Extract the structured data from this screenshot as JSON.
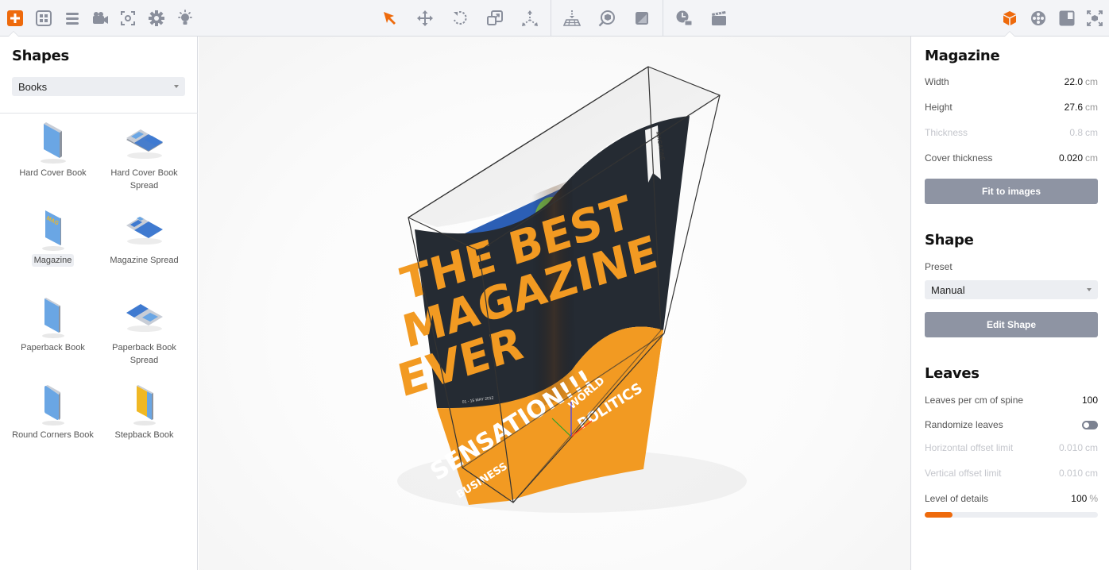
{
  "colors": {
    "accent": "#ee6a0c",
    "icon": "#8a8f9c",
    "button": "#8e94a3"
  },
  "toolbar": {
    "left": [
      {
        "name": "add-icon",
        "active": true
      },
      {
        "name": "library-icon"
      },
      {
        "name": "list-icon"
      },
      {
        "name": "camera-icon"
      },
      {
        "name": "focus-icon"
      },
      {
        "name": "settings-icon"
      },
      {
        "name": "light-icon"
      }
    ],
    "center": [
      {
        "name": "select-icon",
        "active": true
      },
      {
        "name": "move-icon"
      },
      {
        "name": "rotate-icon"
      },
      {
        "name": "scale-icon"
      },
      {
        "name": "explode-icon"
      },
      {
        "name": "drop-to-floor-icon"
      },
      {
        "name": "zoom-to-object-icon"
      },
      {
        "name": "material-icon"
      },
      {
        "name": "timeline-icon"
      },
      {
        "name": "animation-icon"
      }
    ],
    "right": [
      {
        "name": "object-icon",
        "active": true
      },
      {
        "name": "environment-icon"
      },
      {
        "name": "frame-icon"
      },
      {
        "name": "fullscreen-icon"
      }
    ]
  },
  "left_panel": {
    "title": "Shapes",
    "category": "Books",
    "items": [
      {
        "label": "Hard Cover Book",
        "icon": "hard-cover-book-icon"
      },
      {
        "label": "Hard Cover Book Spread",
        "icon": "hard-cover-book-spread-icon"
      },
      {
        "label": "Magazine",
        "icon": "magazine-icon",
        "selected": true
      },
      {
        "label": "Magazine Spread",
        "icon": "magazine-spread-icon"
      },
      {
        "label": "Paperback Book",
        "icon": "paperback-book-icon"
      },
      {
        "label": "Paperback Book Spread",
        "icon": "paperback-book-spread-icon"
      },
      {
        "label": "Round Corners Book",
        "icon": "round-corners-book-icon"
      },
      {
        "label": "Stepback Book",
        "icon": "stepback-book-icon"
      }
    ]
  },
  "viewport": {
    "cover_text": {
      "headline_1": "THE BEST",
      "headline_2": "MAGAZINE",
      "headline_3": "EVER",
      "ribbon": "MAGAZINE",
      "date": "01 - 15 MAY 2012",
      "banner": "SENSATION!!!",
      "sub_1": "BUSINESS",
      "sub_2": "WORLD",
      "sub_3": "POLITICS"
    }
  },
  "right_panel": {
    "magazine": {
      "title": "Magazine",
      "width": {
        "label": "Width",
        "value": "22.0",
        "unit": "cm"
      },
      "height": {
        "label": "Height",
        "value": "27.6",
        "unit": "cm"
      },
      "thickness": {
        "label": "Thickness",
        "value": "0.8",
        "unit": "cm",
        "disabled": true
      },
      "cover_thickness": {
        "label": "Cover thickness",
        "value": "0.020",
        "unit": "cm"
      },
      "fit_button": "Fit to images"
    },
    "shape": {
      "title": "Shape",
      "preset_label": "Preset",
      "preset_value": "Manual",
      "edit_button": "Edit Shape"
    },
    "leaves": {
      "title": "Leaves",
      "per_cm": {
        "label": "Leaves per cm of spine",
        "value": "100"
      },
      "randomize": {
        "label": "Randomize leaves",
        "on": false
      },
      "h_offset": {
        "label": "Horizontal offset limit",
        "value": "0.010",
        "unit": "cm",
        "disabled": true
      },
      "v_offset": {
        "label": "Vertical offset limit",
        "value": "0.010",
        "unit": "cm",
        "disabled": true
      },
      "detail": {
        "label": "Level of details",
        "value": "100",
        "unit": "%",
        "slider_fraction": 0.16
      }
    }
  }
}
